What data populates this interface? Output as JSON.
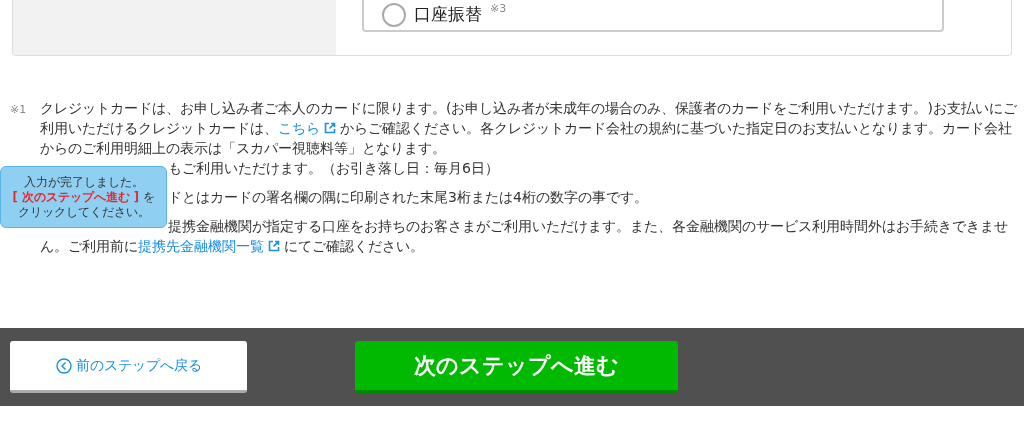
{
  "payment_option": {
    "label": "口座振替",
    "note_ref": "※3",
    "selected": false
  },
  "notes": [
    {
      "mark": "※1",
      "paragraphs": [
        {
          "covered": false,
          "parts": [
            {
              "kind": "text",
              "text": "クレジットカードは、お申し込み者ご本人のカードに限ります。(お申し込み者が未成年の場合のみ、保護者のカードをご利用いただけます。)お支払いにご利用いただけるクレジットカードは、"
            },
            {
              "kind": "link",
              "text": "こちら"
            },
            {
              "kind": "text",
              "text": "からご確認ください。各クレジットカード会社の規約に基づいた指定日のお支払いとなります。カード会社からのご利用明細上の表示は「スカパー視聴料等」となります。"
            }
          ]
        },
        {
          "covered": true,
          "parts": [
            {
              "kind": "text",
              "text": "もご利用いただけます。（お引き落し日：毎月6日）"
            }
          ]
        }
      ]
    },
    {
      "paragraphs": [
        {
          "covered": true,
          "parts": [
            {
              "kind": "text",
              "text": "ドとはカードの署名欄の隅に印刷された末尾3桁または4桁の数字の事です。"
            }
          ]
        }
      ]
    },
    {
      "paragraphs": [
        {
          "covered": true,
          "parts": [
            {
              "kind": "text",
              "text": "提携金融機関が指定する口座をお持ちのお客さまがご利用いただけます。また、各金融機関のサービス利用時間外はお手続きできません。ご利用前に"
            },
            {
              "kind": "link",
              "text": "提携先金融機関一覧"
            },
            {
              "kind": "text",
              "text": "にてご確認ください。"
            }
          ]
        }
      ]
    }
  ],
  "tooltip": {
    "line1": "入力が完了しました。",
    "highlight": "[ 次のステップへ進む ]",
    "after": "を",
    "line3": "クリックしてください。"
  },
  "back_button": "前のステップへ戻る",
  "next_button": "次のステップへ進む"
}
